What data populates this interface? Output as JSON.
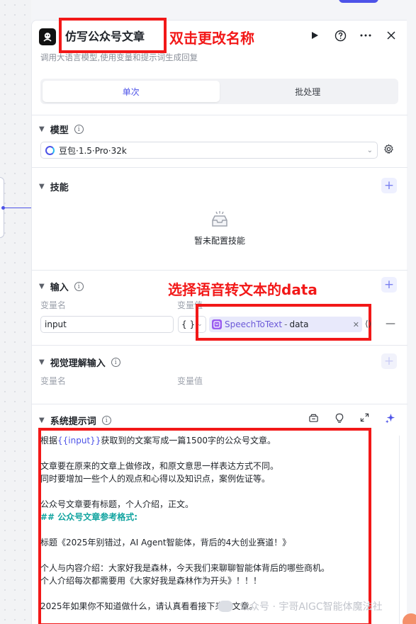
{
  "header": {
    "title": "仿写公众号文章",
    "subtitle": "调用大语言模型,使用变量和提示词生成回复",
    "annotation": "双击更改名称"
  },
  "tabs": [
    {
      "label": "单次",
      "active": true
    },
    {
      "label": "批处理",
      "active": false
    }
  ],
  "model": {
    "section_label": "模型",
    "selected": "豆包·1.5·Pro·32k"
  },
  "skills": {
    "section_label": "技能",
    "empty_text": "暂未配置技能"
  },
  "input": {
    "section_label": "输入",
    "annotation": "选择语音转文本的data",
    "col_name": "变量名",
    "col_value": "变量值",
    "rows": [
      {
        "name": "input",
        "type_icon": "{ }",
        "ref_node": "SpeechToText",
        "ref_sep": "-",
        "ref_var": "data"
      }
    ]
  },
  "vision_input": {
    "section_label": "视觉理解输入",
    "col_name": "变量名",
    "col_value": "变量值"
  },
  "system_prompt": {
    "section_label": "系统提示词",
    "line1_pre": "根据",
    "line1_var": "{{input}}",
    "line1_post": "获取到的文案写成一篇1500字的公众号文章。",
    "lines_a": [
      "",
      "文章要在原来的文章上做修改，和原文意思一样表达方式不同。",
      "同时要增加一些个人的观点和心得以及知识点，案例佐证等。",
      "",
      "公众号文章要有标题，个人介绍，正文。"
    ],
    "md_heading": "## 公众号文章参考格式:",
    "lines_b": [
      "",
      "标题《2025年别错过，AI Agent智能体，背后的4大创业赛道！》",
      "",
      "个人与内容介绍：大家好我是森林，今天我们来聊聊智能体背后的哪些商机。",
      "个人介绍每次都需要用《大家好我是森林作为开头》！！！",
      "",
      "2025年如果你不知道做什么，请认真看看接下来的文章。"
    ]
  },
  "watermark": "公众号 · 宇哥AIGC智能体魔法社",
  "colors": {
    "accent": "#4d53e8",
    "annotation_red": "#f21818",
    "markdown_heading": "#12a4a0"
  }
}
